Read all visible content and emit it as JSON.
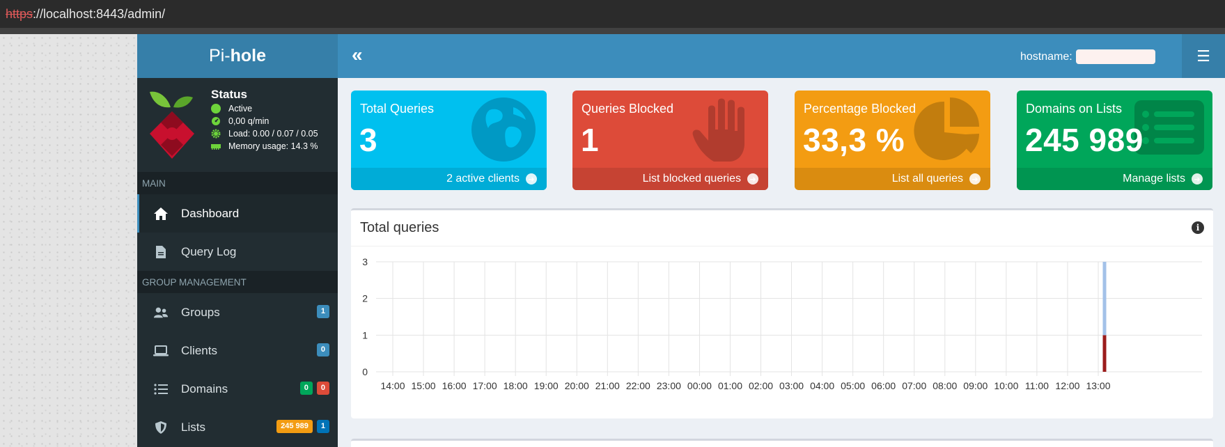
{
  "browser": {
    "url_scheme": "https",
    "url_rest": "://localhost:8443/admin/"
  },
  "brand": {
    "part1": "Pi-",
    "part2": "hole"
  },
  "status": {
    "title": "Status",
    "active": "Active",
    "rate": "0,00 q/min",
    "load": "Load: 0.00 / 0.07 / 0.05",
    "memory": "Memory usage: 14.3 %"
  },
  "sidebar": {
    "main_header": "MAIN",
    "group_header": "GROUP MANAGEMENT",
    "items": {
      "dashboard": "Dashboard",
      "query_log": "Query Log",
      "groups": "Groups",
      "clients": "Clients",
      "domains": "Domains",
      "lists": "Lists"
    },
    "badges": {
      "groups": "1",
      "clients": "0",
      "domains_allow": "0",
      "domains_deny": "0",
      "lists_domains": "245 989",
      "lists_count": "1"
    }
  },
  "header": {
    "collapse_icon": "«",
    "hostname_label": "hostname:",
    "menu_icon": "☰"
  },
  "stats": [
    {
      "title": "Total Queries",
      "value": "3",
      "footer": "2 active clients",
      "color": "#00c0ef",
      "footer_color": "#00acd7",
      "icon": "globe-icon",
      "icon_color": "#0099c4"
    },
    {
      "title": "Queries Blocked",
      "value": "1",
      "footer": "List blocked queries",
      "color": "#dd4b39",
      "footer_color": "#c64333",
      "icon": "hand-icon",
      "icon_color": "#b13c2e"
    },
    {
      "title": "Percentage Blocked",
      "value": "33,3 %",
      "footer": "List all queries",
      "color": "#f39c12",
      "footer_color": "#da8c10",
      "icon": "pie-icon",
      "icon_color": "#c27d0e"
    },
    {
      "title": "Domains on Lists",
      "value": "245 989",
      "footer": "Manage lists",
      "color": "#00a65a",
      "footer_color": "#009551",
      "icon": "list-icon",
      "icon_color": "#008548"
    }
  ],
  "chart_title": "Total queries",
  "chart_data": {
    "type": "bar",
    "title": "Total queries",
    "categories": [
      "14:00",
      "15:00",
      "16:00",
      "17:00",
      "18:00",
      "19:00",
      "20:00",
      "21:00",
      "22:00",
      "23:00",
      "00:00",
      "01:00",
      "02:00",
      "03:00",
      "04:00",
      "05:00",
      "06:00",
      "07:00",
      "08:00",
      "09:00",
      "10:00",
      "11:00",
      "12:00",
      "13:00"
    ],
    "ylim": [
      0,
      3
    ],
    "yticks": [
      0,
      1,
      2,
      3
    ],
    "stacked": true,
    "series": [
      {
        "color": "#9b1c1c",
        "values": [
          0,
          0,
          0,
          0,
          0,
          0,
          0,
          0,
          0,
          0,
          0,
          0,
          0,
          0,
          0,
          0,
          0,
          0,
          0,
          0,
          0,
          0,
          0,
          1
        ]
      },
      {
        "color": "#a3c1e8",
        "values": [
          0,
          0,
          0,
          0,
          0,
          0,
          0,
          0,
          0,
          0,
          0,
          0,
          0,
          0,
          0,
          0,
          0,
          0,
          0,
          0,
          0,
          0,
          0,
          2
        ]
      }
    ],
    "grid": true,
    "legend": "none"
  }
}
